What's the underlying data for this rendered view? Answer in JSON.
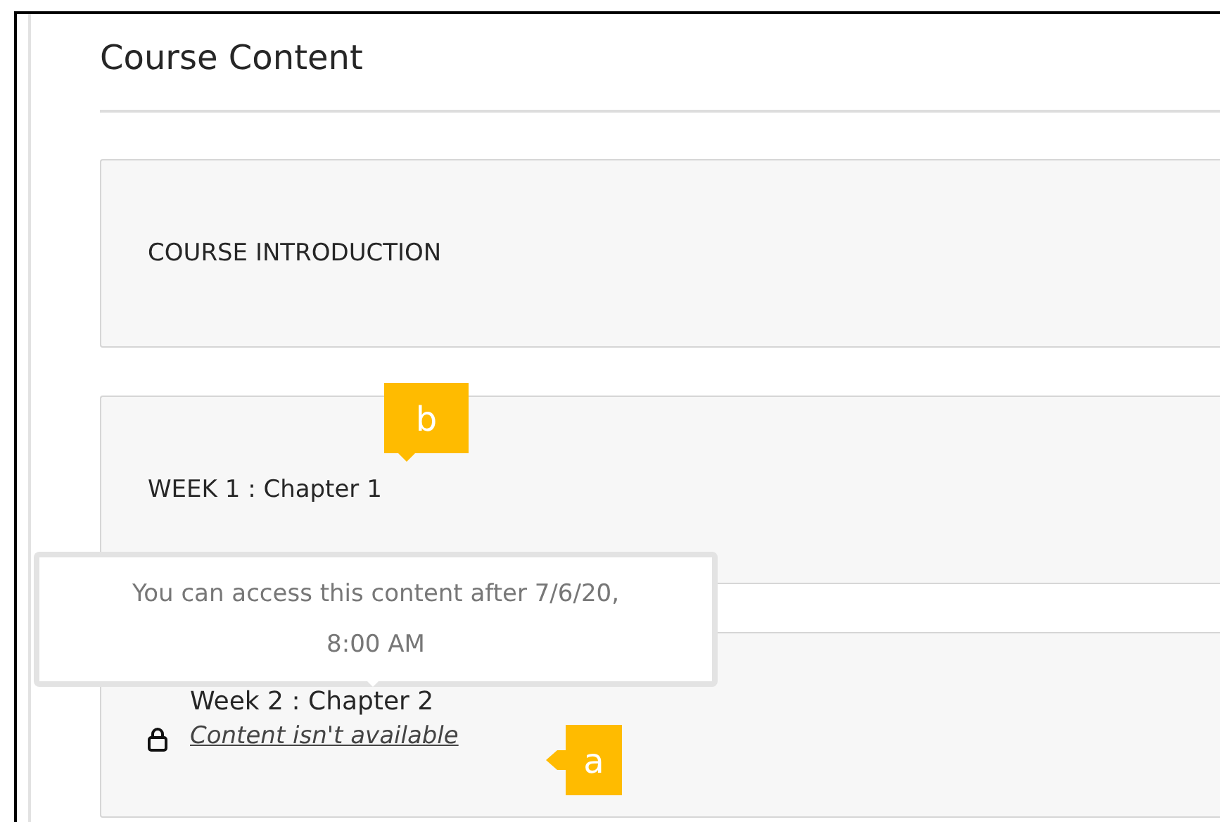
{
  "heading": "Course Content",
  "items": [
    {
      "title": "COURSE INTRODUCTION",
      "locked": false
    },
    {
      "title": "WEEK 1 : Chapter 1",
      "locked": false
    },
    {
      "title": "Week 2 : Chapter 2",
      "locked": true,
      "status": "Content isn't available"
    }
  ],
  "tooltip": {
    "text": "You can access this content after 7/6/20, 8:00 AM"
  },
  "callouts": [
    {
      "label": "b"
    },
    {
      "label": "a"
    }
  ]
}
